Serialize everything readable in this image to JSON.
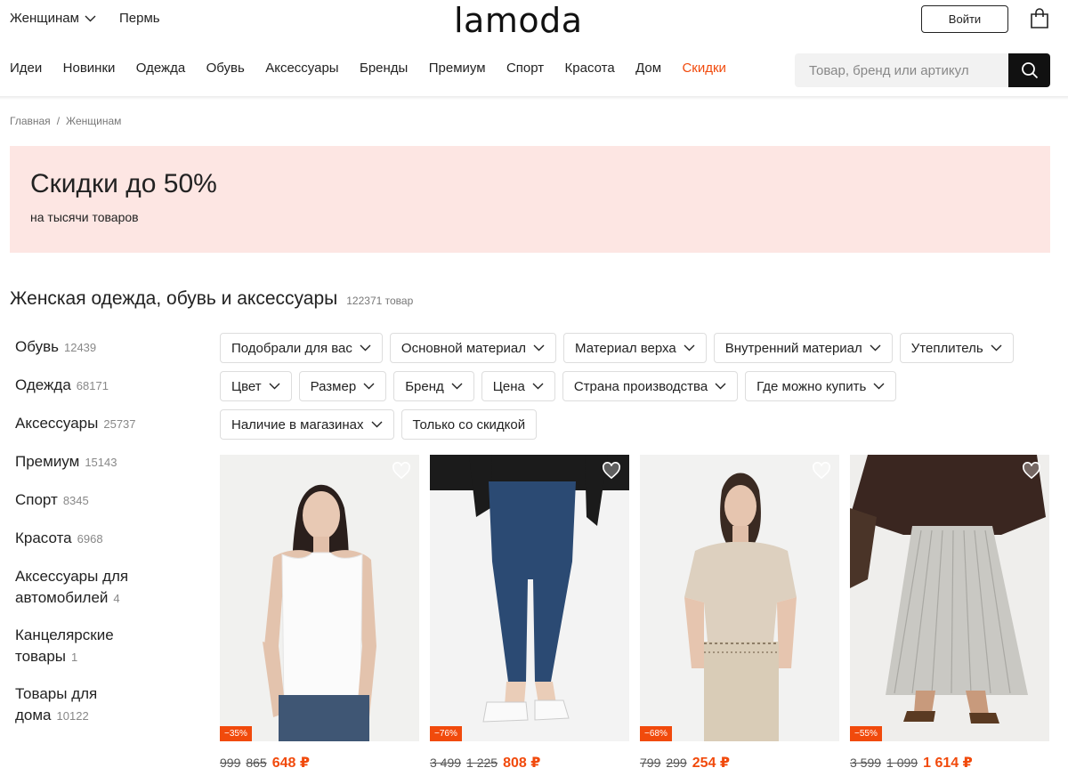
{
  "header": {
    "gender": "Женщинам",
    "city": "Пермь",
    "logo": "lamoda",
    "login_label": "Войти",
    "cart_icon": "shopping-bag-icon"
  },
  "nav": {
    "items": [
      "Идеи",
      "Новинки",
      "Одежда",
      "Обувь",
      "Аксессуары",
      "Бренды",
      "Премиум",
      "Спорт",
      "Красота",
      "Дом",
      "Скидки"
    ],
    "accent_color": "#f14a0c"
  },
  "search": {
    "placeholder": "Товар, бренд или артикул",
    "icon": "search-icon"
  },
  "breadcrumb": [
    "Главная",
    "Женщинам"
  ],
  "promo": {
    "title": "Скидки до 50%",
    "subtitle": "на тысячи товаров",
    "background": "#fde6e3"
  },
  "page": {
    "title": "Женская одежда, обувь и аксессуары",
    "count": "122371 товар"
  },
  "sidebar": {
    "items": [
      {
        "label": "Обувь",
        "count": "12439"
      },
      {
        "label": "Одежда",
        "count": "68171"
      },
      {
        "label": "Аксессуары",
        "count": "25737"
      },
      {
        "label": "Премиум",
        "count": "15143"
      },
      {
        "label": "Спорт",
        "count": "8345"
      },
      {
        "label": "Красота",
        "count": "6968"
      },
      {
        "label": "Аксессуары для автомобилей",
        "count": "4"
      },
      {
        "label": "Канцелярские товары",
        "count": "1"
      },
      {
        "label": "Товары для дома",
        "count": "10122"
      }
    ]
  },
  "filters": {
    "row1": [
      "Подобрали для вас",
      "Основной материал",
      "Материал верха",
      "Внутренний материал",
      "Утеплитель"
    ],
    "row2": [
      "Цвет",
      "Размер",
      "Бренд",
      "Цена",
      "Страна производства",
      "Где можно купить"
    ],
    "row3": [
      "Наличие в магазинах"
    ],
    "toggle": "Только со скидкой"
  },
  "products": [
    {
      "discount": "−35%",
      "old_price": "999",
      "prev_price": "865",
      "price": "648 ₽"
    },
    {
      "discount": "−76%",
      "old_price": "3 499",
      "prev_price": "1 225",
      "price": "808 ₽"
    },
    {
      "discount": "−68%",
      "old_price": "799",
      "prev_price": "299",
      "price": "254 ₽"
    },
    {
      "discount": "−55%",
      "old_price": "3 599",
      "prev_price": "1 099",
      "price": "1 614 ₽"
    }
  ]
}
